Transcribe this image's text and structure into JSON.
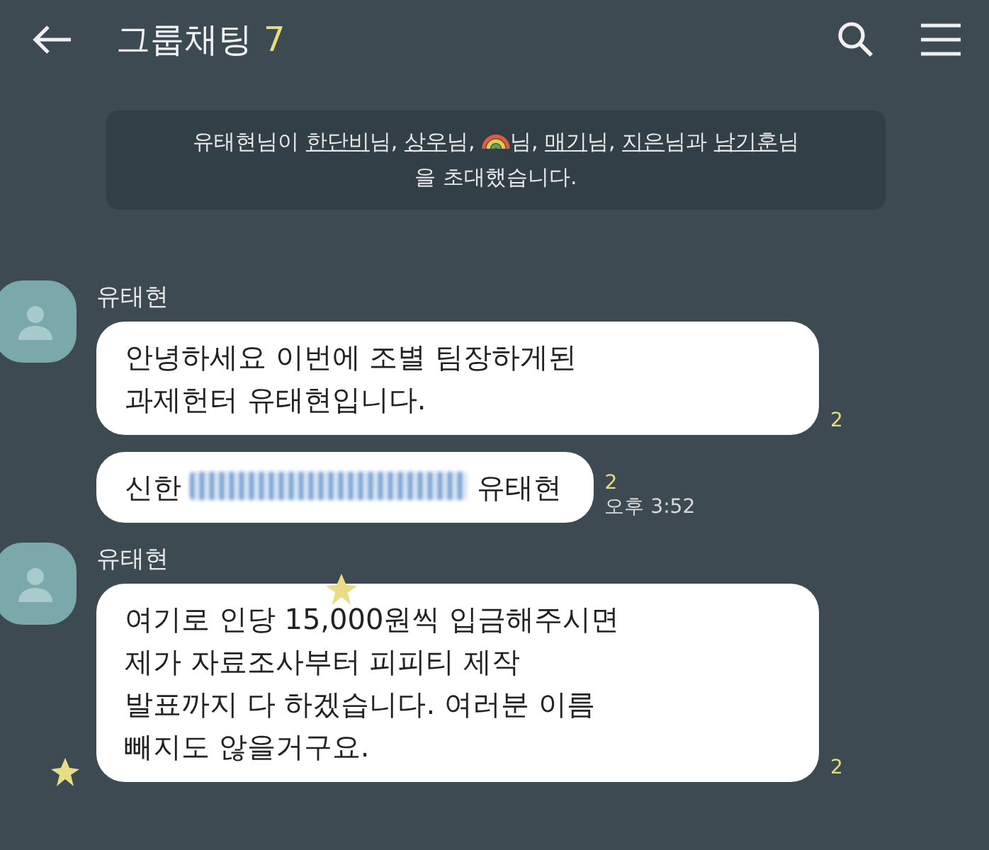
{
  "header": {
    "title": "그룹채팅",
    "member_count": "7"
  },
  "notice": {
    "parts": [
      {
        "kind": "text",
        "text": "유태현님이 "
      },
      {
        "kind": "name",
        "text": "한단비"
      },
      {
        "kind": "text",
        "text": "님, "
      },
      {
        "kind": "name",
        "text": "상우"
      },
      {
        "kind": "text",
        "text": "님, "
      },
      {
        "kind": "emoji"
      },
      {
        "kind": "text",
        "text": "님, "
      },
      {
        "kind": "name",
        "text": "매기"
      },
      {
        "kind": "text",
        "text": "님, "
      },
      {
        "kind": "name",
        "text": "지은"
      },
      {
        "kind": "text",
        "text": "님과 "
      },
      {
        "kind": "name",
        "text": "남기훈"
      },
      {
        "kind": "text",
        "text": "님을 초대했습니다."
      }
    ]
  },
  "groups": [
    {
      "sender": "유태현",
      "messages": [
        {
          "kind": "text",
          "text": "안녕하세요 이번에 조별 팀장하게된\n과제헌터 유태현입니다.",
          "unread": "2"
        },
        {
          "kind": "account",
          "before": "신한",
          "after": "유태현",
          "unread": "2",
          "time": "오후 3:52"
        }
      ]
    },
    {
      "sender": "유태현",
      "messages": [
        {
          "kind": "text",
          "text": "여기로 인당 15,000원씩 입금해주시면\n제가 자료조사부터 피피티 제작\n발표까지 다 하겠습니다. 여러분 이름\n빼지도 않을거구요.",
          "unread": "2"
        }
      ]
    }
  ]
}
